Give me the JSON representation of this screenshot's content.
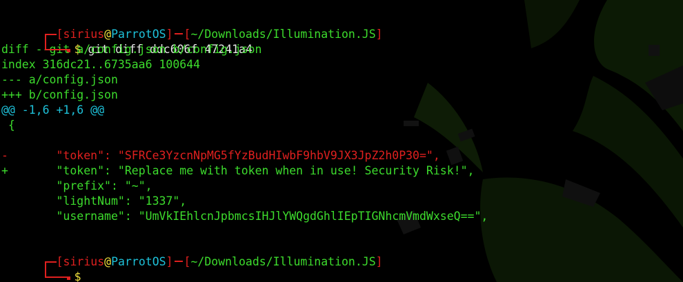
{
  "prompt": {
    "user": "sirius",
    "at": "@",
    "host": "ParrotOS",
    "open_bracket": "[",
    "close_bracket": "]",
    "path": "~/Downloads/Illumination.JS",
    "symbol": "$"
  },
  "command": "git diff ddc606f 47241a4",
  "diff_header": {
    "diff_line": "diff --git a/config.json b/config.json",
    "index_line": "index 316dc21..6735aa6 100644",
    "old_file": "--- a/config.json",
    "new_file": "+++ b/config.json",
    "hunk": "@@ -1,6 +1,6 @@"
  },
  "diff_body": {
    "open_brace": " {",
    "blank": "",
    "removed_marker": "-",
    "removed_key": "\"token\"",
    "removed_value": "\"SFRCe3YzcnNpMG5fYzBudHIwbF9hbV9JX3JpZ2h0P30=\",",
    "added_marker": "+",
    "added_key": "\"token\"",
    "added_value": "\"Replace me with token when in use! Security Risk!\",",
    "ctx_prefix_key": "\"prefix\"",
    "ctx_prefix_value": "\"~\",",
    "ctx_lightnum_key": "\"lightNum\"",
    "ctx_lightnum_value": "\"1337\",",
    "ctx_username_key": "\"username\"",
    "ctx_username_value": "\"UmVkIEhlcnJpbmcsIHJlYWQgdGhlIEpTIGNhcmVmdWxseQ==\","
  },
  "colors": {
    "background": "#000000",
    "prompt_red": "#e0201f",
    "prompt_cyan": "#1ec1d9",
    "prompt_yellow": "#f0e03c",
    "diff_green": "#3ddc2d",
    "diff_red": "#e0201f"
  }
}
